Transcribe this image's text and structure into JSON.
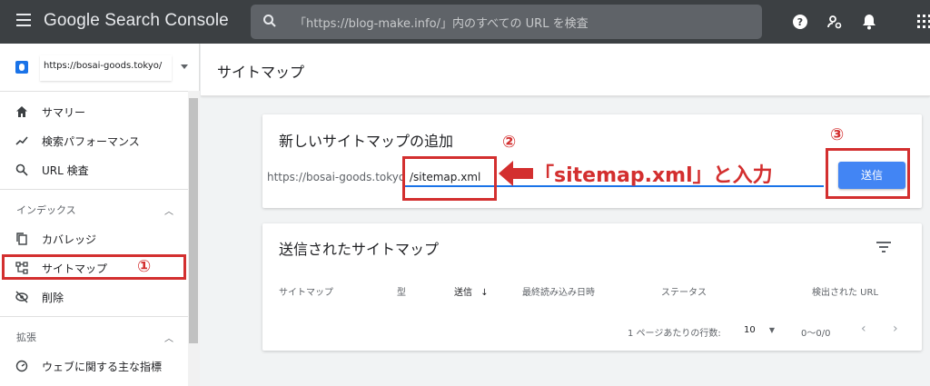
{
  "app": {
    "title": "Google Search Console"
  },
  "search": {
    "placeholder": "「https://blog-make.info/」内のすべての URL を検査"
  },
  "property": {
    "label": "https://bosai-goods.tokyo/"
  },
  "sidebar": {
    "items_top": [
      {
        "label": "サマリー",
        "icon": "home-icon"
      },
      {
        "label": "検索パフォーマンス",
        "icon": "trending-icon"
      },
      {
        "label": "URL 検査",
        "icon": "search-icon"
      }
    ],
    "section_index": "インデックス",
    "items_index": [
      {
        "label": "カバレッジ",
        "icon": "copy-icon"
      },
      {
        "label": "サイトマップ",
        "icon": "sitemap-icon"
      },
      {
        "label": "削除",
        "icon": "eye-off-icon"
      }
    ],
    "section_ext": "拡張",
    "items_ext": [
      {
        "label": "ウェブに関する主な指標",
        "icon": "gauge-icon"
      }
    ]
  },
  "page": {
    "title": "サイトマップ"
  },
  "add_card": {
    "title": "新しいサイトマップの追加",
    "prefix": "https://bosai-goods.tokyo",
    "input_value": "/sitemap.xml",
    "submit_label": "送信"
  },
  "submitted_card": {
    "title": "送信されたサイトマップ",
    "columns": [
      "サイトマップ",
      "型",
      "送信",
      "最終読み込み日時",
      "ステータス",
      "検出された URL"
    ],
    "sort_arrow": "↓",
    "rows_per_page_label": "1 ページあたりの行数:",
    "rows_per_page_value": "10",
    "range": "0〜0/0",
    "prev": "‹",
    "next": "›"
  },
  "annotations": {
    "step1": "①",
    "step2": "②",
    "step3": "③",
    "instruction": "「sitemap.xml」と入力"
  },
  "colors": {
    "topbar": "#3c4043",
    "accent": "#4285f4",
    "annotation_red": "#d32f2f"
  }
}
